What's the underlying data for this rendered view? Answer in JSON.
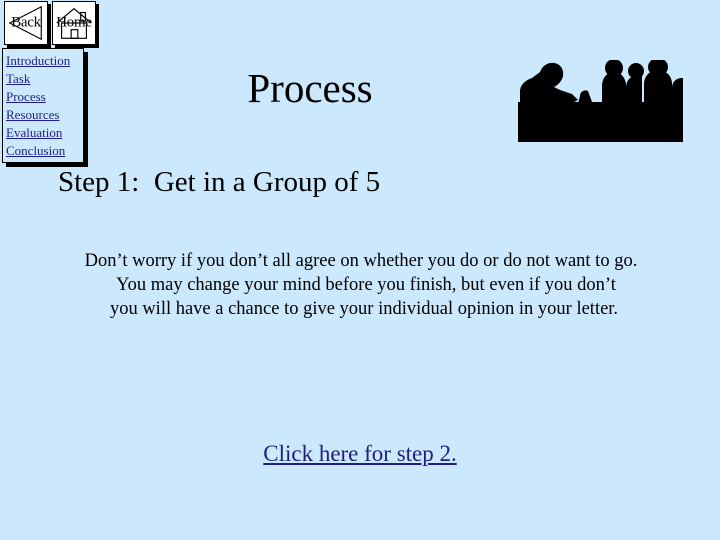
{
  "theme": {
    "background": "#cce8fc",
    "link_color": "#202080",
    "sidebar_link_color": "#1f1f8f",
    "text_color": "#000000",
    "button_background": "#ffffff",
    "silhouette_color": "#000000"
  },
  "nav_buttons": [
    {
      "label": "Back",
      "icon": "back-triangle-icon"
    },
    {
      "label": "Home",
      "icon": "house-icon"
    }
  ],
  "sidebar": {
    "items": [
      {
        "label": "Introduction"
      },
      {
        "label": "Task"
      },
      {
        "label": "Process"
      },
      {
        "label": "Resources"
      },
      {
        "label": "Evaluation"
      },
      {
        "label": "Conclusion"
      }
    ]
  },
  "header": {
    "title": "Process",
    "image_alt": "group-meeting-silhouette"
  },
  "main": {
    "step_heading": "Step 1:  Get in a Group of 5",
    "paragraph_lines": [
      "Don’t worry if you don’t all agree on whether you do or do not want to go.",
      "You may change your mind before you finish, but even if you don’t",
      "you will have a chance to give your individual opinion in your letter."
    ],
    "next_step_link": "Click here for step 2."
  }
}
